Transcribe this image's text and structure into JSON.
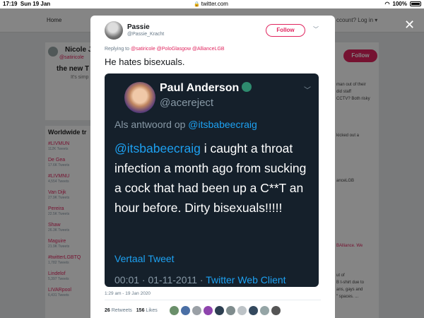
{
  "statusbar": {
    "time": "17:19",
    "date": "Sun 19 Jan",
    "url": "twitter.com",
    "battery": "100%"
  },
  "background": {
    "nav_home": "Home",
    "account_menu": "ccount? Log in ▾",
    "profile_name": "Nicole J",
    "profile_handle": "@satiricole",
    "profile_tagline": "the new T",
    "profile_small": "It's simp",
    "right_follow": "Follow",
    "trends_title": "Worldwide tr",
    "trends": [
      {
        "name": "#LIVMUN",
        "count": "112K Tweets"
      },
      {
        "name": "De Gea",
        "count": "17.6K Tweets"
      },
      {
        "name": "#LIVMNU",
        "count": "4,554 Tweets"
      },
      {
        "name": "Van Dijk",
        "count": "27.9K Tweets"
      },
      {
        "name": "Pereira",
        "count": "22.5K Tweets"
      },
      {
        "name": "Shaw",
        "count": "26.3K Tweets"
      },
      {
        "name": "Maguire",
        "count": "21.9K Tweets"
      },
      {
        "name": "#twitterLGBTQ",
        "count": "1,782 Tweets"
      },
      {
        "name": "Lindelof",
        "count": "5,397 Tweets"
      },
      {
        "name": "LIVARpool",
        "count": "6,431 Tweets"
      }
    ],
    "right_snippets": [
      {
        "text": "man out of their",
        "link": false
      },
      {
        "text": "did staff",
        "link": false
      },
      {
        "text": "CCTV? Both risky",
        "link": false
      },
      {
        "text": "kicked out a",
        "link": false
      },
      {
        "text": "anceLGB",
        "link": false
      },
      {
        "text": "BAlliance. We",
        "link": true
      },
      {
        "text": "ut of",
        "link": false
      },
      {
        "text": "B t-shirt due to",
        "link": false
      },
      {
        "text": "ans, gays and",
        "link": false
      },
      {
        "text": "\" spaces. ...",
        "link": false
      }
    ]
  },
  "modal": {
    "author_name": "Passie",
    "author_handle": "@Passie_Kracht",
    "follow_label": "Follow",
    "replying_prefix": "Replying to",
    "replying_to": "@satiricole @PoloGlasgow @AllianceLGB",
    "text": "He hates bisexuals.",
    "embed": {
      "name": "Paul Anderson",
      "handle": "@acereject",
      "reply_prefix": "Als antwoord op",
      "reply_to": "@itsbabeecraig",
      "body_mention": "@itsbabeecraig",
      "body": " i caught a throat infection a month ago from sucking a cock that had been up a C**T an hour before. Dirty bisexuals!!!!!",
      "translate": "Vertaal Tweet",
      "meta_time": "00:01 · 01-11-2011 ·",
      "meta_client": "Twitter Web Client"
    },
    "timestamp": "1:29 am - 19 Jan 2020",
    "retweets_count": "26",
    "retweets_label": "Retweets",
    "likes_count": "156",
    "likes_label": "Likes",
    "liker_colors": [
      "#6a8f6a",
      "#4a6fa5",
      "#9aa0a6",
      "#8e44ad",
      "#2c3e50",
      "#7f8c8d",
      "#bdc3c7",
      "#34495e",
      "#95a5a6",
      "#555555"
    ]
  },
  "icons": {
    "close": "close-icon",
    "lock": "lock-icon",
    "chevron": "chevron-down-icon",
    "verified": "peacock-badge-icon"
  }
}
